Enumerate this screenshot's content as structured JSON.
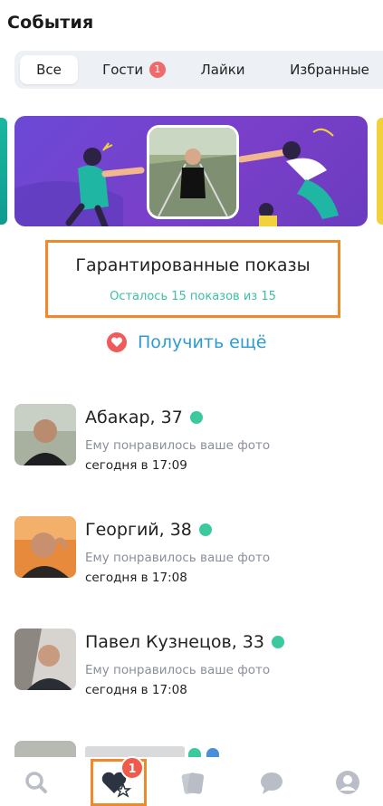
{
  "header": {
    "title": "События"
  },
  "tabs": [
    {
      "label": "Все",
      "active": true
    },
    {
      "label": "Гости",
      "badge": "1"
    },
    {
      "label": "Лайки"
    },
    {
      "label": "Избранные"
    }
  ],
  "guaranteed": {
    "title": "Гарантированные показы",
    "subtitle": "Осталось 15 показов из 15"
  },
  "get_more": {
    "label": "Получить ещё",
    "icon": "heart-icon"
  },
  "events": [
    {
      "name": "Абакар, 37",
      "text": "Ему понравилось ваше фото",
      "time": "сегодня в 17:09",
      "online": true
    },
    {
      "name": "Георгий, 38",
      "text": "Ему понравилось ваше фото",
      "time": "сегодня в 17:08",
      "online": true
    },
    {
      "name": "Павел Кузнецов, 33",
      "text": "Ему понравилось ваше фото",
      "time": "сегодня в 17:08",
      "online": true
    }
  ],
  "bottom_nav": {
    "items": [
      "search-icon",
      "favorites-icon",
      "cards-icon",
      "chat-icon",
      "profile-icon"
    ],
    "favorites_badge": "1"
  },
  "colors": {
    "accent_teal": "#3cbfa2",
    "link_blue": "#2d9bd2",
    "highlight_orange": "#f0892a",
    "badge_red": "#ef6b6b",
    "banner_purple": "#6b49d6"
  }
}
